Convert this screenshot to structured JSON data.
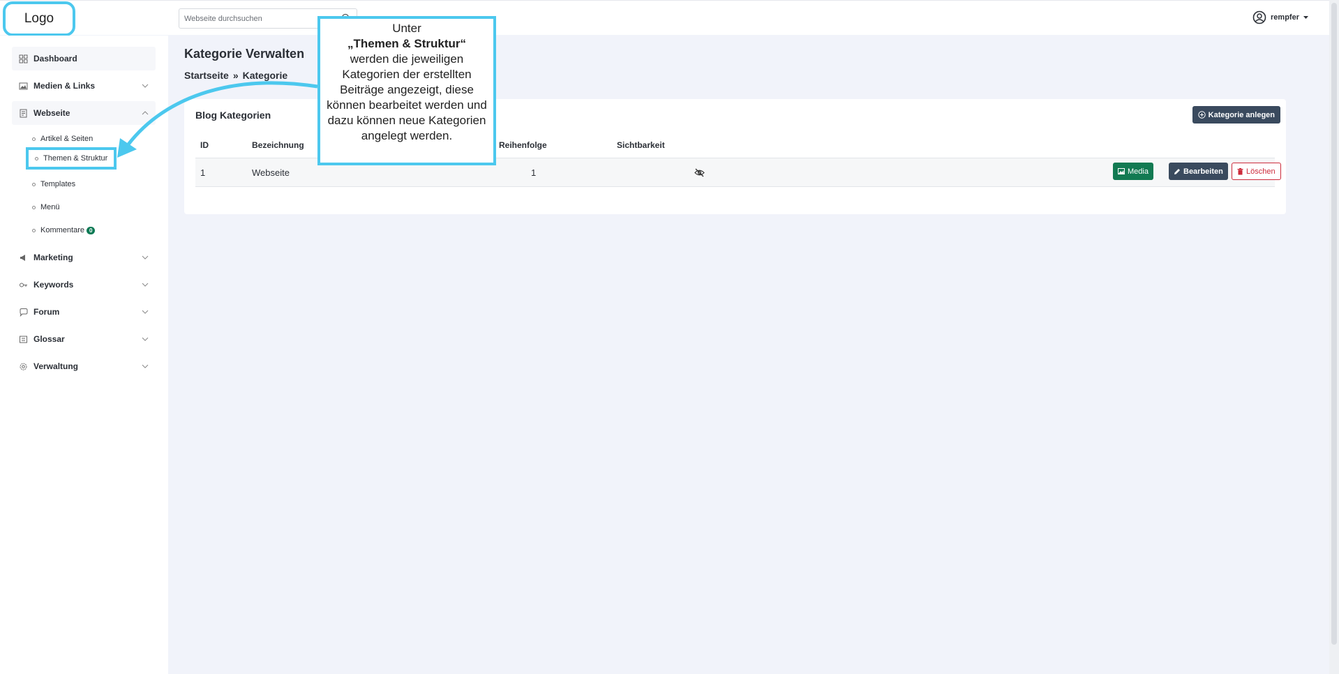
{
  "header": {
    "logo": "Logo",
    "search_placeholder": "Webseite durchsuchen",
    "user_name": "rempfer"
  },
  "sidebar": {
    "items": [
      {
        "label": "Dashboard",
        "icon": "grid-icon"
      },
      {
        "label": "Medien & Links",
        "icon": "image-icon"
      },
      {
        "label": "Webseite",
        "icon": "document-icon"
      },
      {
        "label": "Marketing",
        "icon": "megaphone-icon"
      },
      {
        "label": "Keywords",
        "icon": "key-icon"
      },
      {
        "label": "Forum",
        "icon": "chat-icon"
      },
      {
        "label": "Glossar",
        "icon": "book-icon"
      },
      {
        "label": "Verwaltung",
        "icon": "gear-icon"
      }
    ],
    "sub_items": [
      {
        "label": "Artikel & Seiten"
      },
      {
        "label": "Themen & Struktur"
      },
      {
        "label": "Templates"
      },
      {
        "label": "Menü"
      },
      {
        "label": "Kommentare",
        "badge": "0"
      }
    ]
  },
  "main": {
    "title": "Kategorie Verwalten",
    "breadcrumb": {
      "home": "Startseite",
      "sep": "»",
      "current": "Kategorie"
    },
    "card": {
      "title": "Blog Kategorien",
      "new_button": "Kategorie anlegen",
      "columns": [
        "ID",
        "Bezeichnung",
        "Reihenfolge",
        "Sichtbarkeit"
      ],
      "rows": [
        {
          "id": "1",
          "name": "Webseite",
          "order": "1",
          "visibility_icon": "eye-slash-icon"
        }
      ],
      "actions": {
        "media": "Media",
        "edit": "Bearbeiten",
        "delete": "Löschen"
      }
    }
  },
  "callout": {
    "line1": "Unter",
    "bold": "„Themen & Struktur“",
    "rest": "werden die jeweiligen Kategorien der erstellten Beiträge angezeigt, diese können bearbeitet werden und dazu können neue Kategorien angelegt werden."
  },
  "colors": {
    "accent": "#4cc8ee",
    "dark_button": "#3a4a5e",
    "success": "#127a52",
    "danger": "#cc2a3a"
  }
}
